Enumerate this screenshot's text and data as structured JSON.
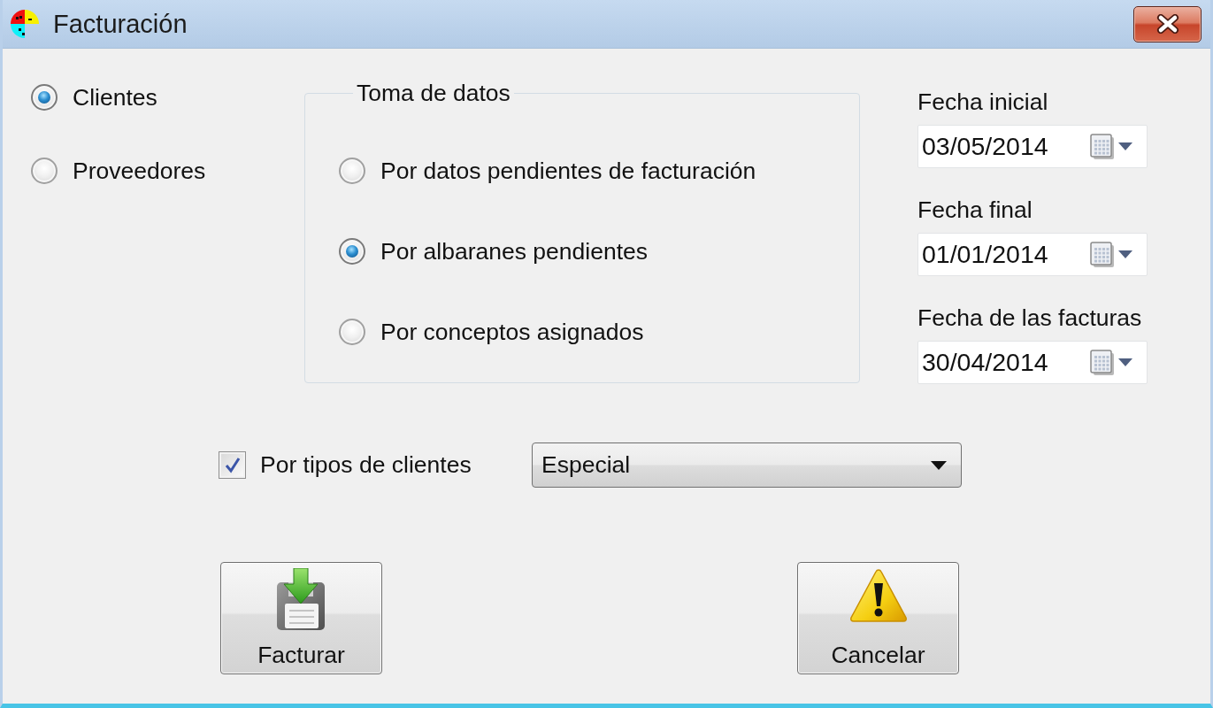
{
  "window": {
    "title": "Facturación"
  },
  "party_options": [
    {
      "label": "Clientes",
      "selected": true
    },
    {
      "label": "Proveedores",
      "selected": false
    }
  ],
  "data_source": {
    "title": "Toma de datos",
    "options": [
      {
        "label": "Por datos pendientes de facturación",
        "selected": false
      },
      {
        "label": "Por albaranes pendientes",
        "selected": true
      },
      {
        "label": "Por conceptos asignados",
        "selected": false
      }
    ]
  },
  "dates": [
    {
      "label": "Fecha inicial",
      "value": "03/05/2014"
    },
    {
      "label": "Fecha final",
      "value": "01/01/2014"
    },
    {
      "label": "Fecha de las facturas",
      "value": "30/04/2014"
    }
  ],
  "client_type_filter": {
    "label": "Por tipos de clientes",
    "checked": true,
    "value": "Especial"
  },
  "buttons": [
    {
      "label": "Facturar",
      "kind": "invoice"
    },
    {
      "label": "Cancelar",
      "kind": "cancel"
    }
  ]
}
